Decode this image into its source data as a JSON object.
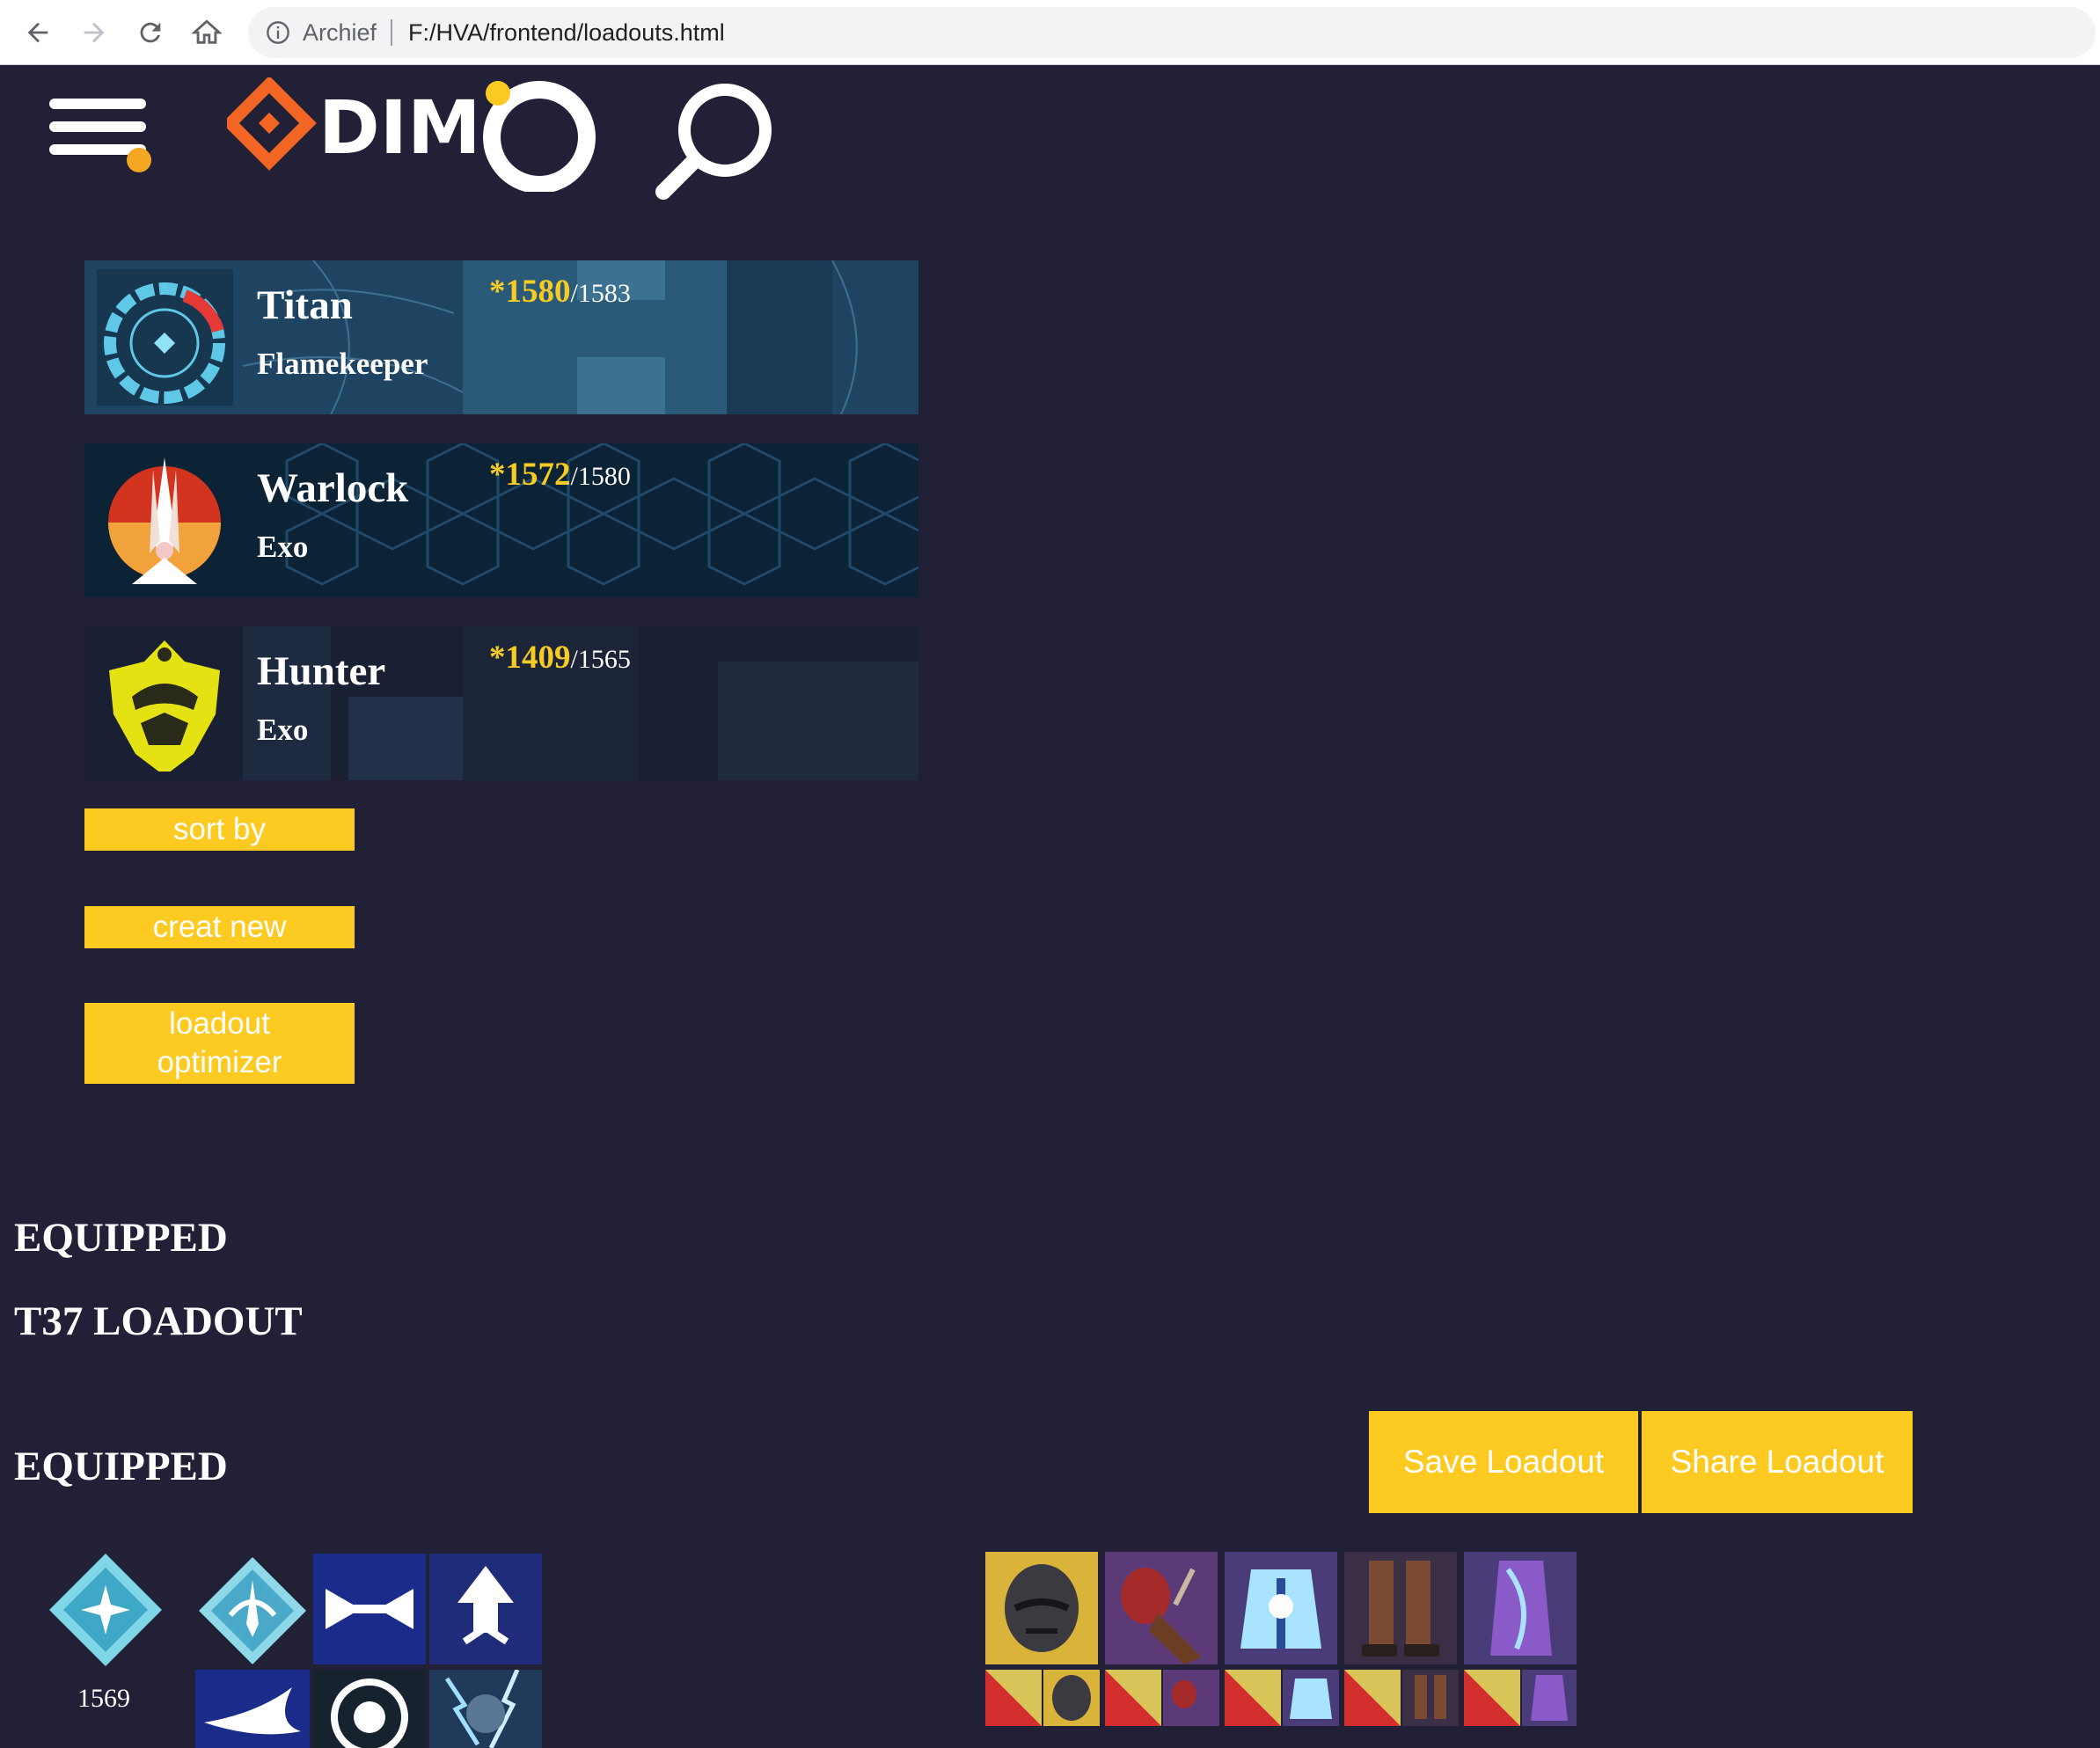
{
  "browser": {
    "back_icon": "arrow-left-icon",
    "forward_icon": "arrow-right-icon",
    "reload_icon": "reload-icon",
    "home_icon": "home-icon",
    "site_label": "Archief",
    "url": "F:/HVA/frontend/loadouts.html"
  },
  "header": {
    "logo_text": "DIM",
    "menu_icon": "hamburger-menu-icon",
    "search_icon": "search-icon"
  },
  "characters": [
    {
      "class": "Titan",
      "race": "Flamekeeper",
      "power_prefix": "*",
      "power": "1580",
      "max_power": "/1583"
    },
    {
      "class": "Warlock",
      "race": "Exo",
      "power_prefix": "*",
      "power": "1572",
      "max_power": "/1580"
    },
    {
      "class": "Hunter",
      "race": "Exo",
      "power_prefix": "*",
      "power": "1409",
      "max_power": "/1565"
    }
  ],
  "sidebar_buttons": {
    "sort_by": "sort by",
    "create_new": "creat new",
    "loadout_optimizer_line1": "loadout",
    "loadout_optimizer_line2": "optimizer"
  },
  "sections": {
    "equipped_top": "EQUIPPED",
    "loadout_name": "T37 LOADOUT",
    "equipped_bottom": "EQUIPPED"
  },
  "actions": {
    "save": "Save Loadout",
    "share": "Share Loadout"
  },
  "loadout": {
    "power": "1569"
  },
  "colors": {
    "background": "#212036",
    "accent": "#fdca21",
    "power_text": "#f6cb23",
    "logo_orange": "#f26522"
  }
}
